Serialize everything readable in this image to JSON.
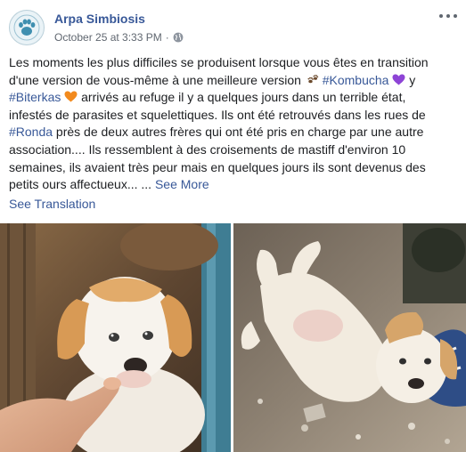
{
  "post": {
    "author": "Arpa Simbiosis",
    "timestamp": "October 25 at 3:33 PM",
    "separator": "·",
    "privacy_icon": "globe-icon",
    "menu_icon": "more-options-icon",
    "text": {
      "l1": "Les moments les plus difficiles se produisent lorsque vous êtes en transition",
      "l2a": "d'une version de vous-même à une meilleure version ",
      "l2_emoji": "paw-prints-emoji",
      "l2b": " ",
      "tag_kombucha": "#Kombucha",
      "l2_heart_color": "#8e44d6",
      "l2c": " y",
      "tag_biterkas": "#Biterkas",
      "l3_heart_color": "#f28a1e",
      "l3b": " arrivés au refuge il y a quelques jours dans un terrible état,",
      "l4": "infestés de parasites et squelettiques. Ils ont été retrouvés dans les rues de",
      "tag_ronda": "#Ronda",
      "l5b": " près de deux autres frères qui ont été pris en charge par une autre",
      "l6": "association.... Ils ressemblent à des croisements de mastiff d'environ 10",
      "l7": "semaines, ils avaient très peur mais en quelques jours ils sont devenus des",
      "l8": "petits ours affectueux... ... ",
      "see_more": "See More"
    },
    "see_translation": "See Translation",
    "photos": [
      {
        "subject": "puppy-licking-finger-photo"
      },
      {
        "subject": "puppy-lying-on-back-photo"
      }
    ],
    "colors": {
      "link": "#385898",
      "text": "#1c1e21",
      "meta": "#606770"
    }
  }
}
